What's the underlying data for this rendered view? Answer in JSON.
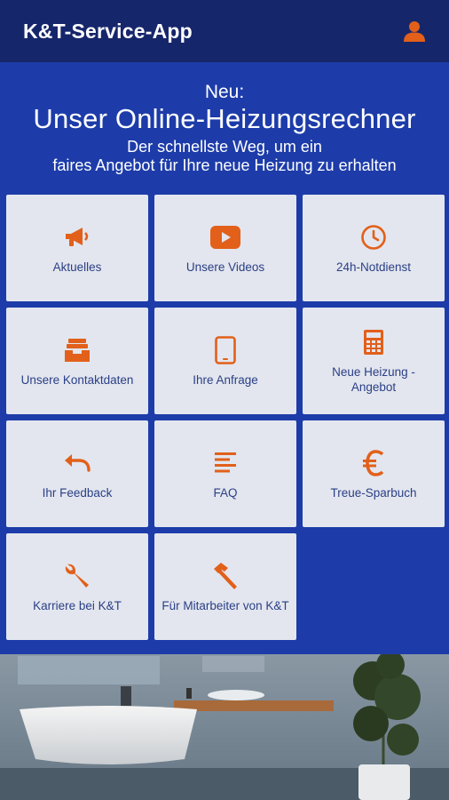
{
  "header": {
    "title": "K&T-Service-App",
    "user_icon": "user-icon"
  },
  "banner": {
    "kicker": "Neu:",
    "title": "Unser Online-Heizungsrechner",
    "subtitle_line1": "Der schnellste Weg, um ein",
    "subtitle_line2": "faires Angebot für Ihre neue Heizung zu erhalten"
  },
  "tiles": [
    {
      "label": "Aktuelles",
      "icon": "megaphone-icon"
    },
    {
      "label": "Unsere Videos",
      "icon": "youtube-play-icon"
    },
    {
      "label": "24h-Notdienst",
      "icon": "clock-icon"
    },
    {
      "label": "Unsere Kontaktdaten",
      "icon": "inbox-icon"
    },
    {
      "label": "Ihre Anfrage",
      "icon": "tablet-icon"
    },
    {
      "label": "Neue Heizung - Angebot",
      "icon": "calculator-icon"
    },
    {
      "label": "Ihr Feedback",
      "icon": "undo-arrow-icon"
    },
    {
      "label": "FAQ",
      "icon": "text-lines-icon"
    },
    {
      "label": "Treue-Sparbuch",
      "icon": "euro-icon"
    },
    {
      "label": "Karriere bei K&T",
      "icon": "wrench-icon"
    },
    {
      "label": "Für Mitarbeiter von K&T",
      "icon": "hammer-icon"
    }
  ],
  "colors": {
    "accent": "#e2601a",
    "header_bg": "#16266b",
    "content_bg": "#1d3ca9",
    "tile_bg": "#e3e6ee",
    "tile_text": "#2a3f86"
  }
}
